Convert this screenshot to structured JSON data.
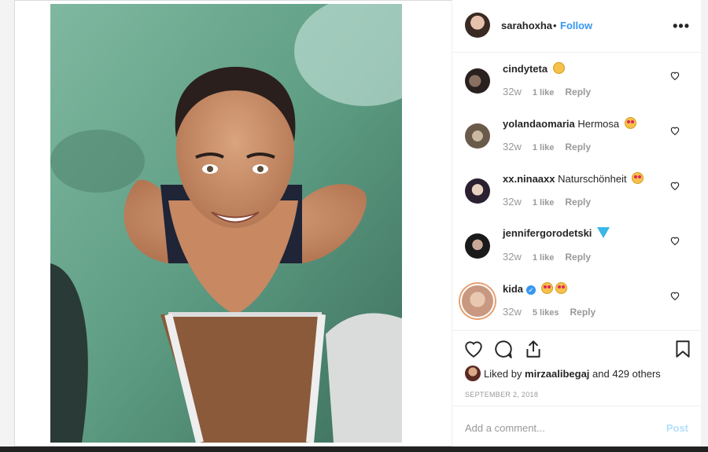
{
  "post": {
    "author": "sarahoxha",
    "separator": "•",
    "follow_label": "Follow",
    "more_label": "•••",
    "likes_text_prefix": "Liked by",
    "likes_user": "mirzaalibegaj",
    "likes_text_suffix": "and 429 others",
    "date": "SEPTEMBER 2, 2018",
    "add_comment_placeholder": "Add a comment...",
    "post_button_label": "Post"
  },
  "comments": [
    {
      "user": "cindyteta",
      "text": "",
      "emoji": "worried-face",
      "time": "32w",
      "likes": "1 like",
      "reply": "Reply"
    },
    {
      "user": "yolandaomaria",
      "text": "Hermosa",
      "emoji": "heart-eyes",
      "time": "32w",
      "likes": "1 like",
      "reply": "Reply"
    },
    {
      "user": "xx.ninaaxx",
      "text": "Naturschönheit",
      "emoji": "heart-eyes",
      "time": "32w",
      "likes": "1 like",
      "reply": "Reply"
    },
    {
      "user": "jennifergorodetski",
      "text": "",
      "emoji": "gem",
      "time": "32w",
      "likes": "1 like",
      "reply": "Reply"
    },
    {
      "user": "kida",
      "text": "",
      "emoji": "heart-eyes-x2",
      "time": "32w",
      "likes": "5 likes",
      "reply": "Reply",
      "verified": true
    }
  ],
  "colors": {
    "accent": "#3897f0",
    "muted": "#999999",
    "text": "#262626"
  }
}
